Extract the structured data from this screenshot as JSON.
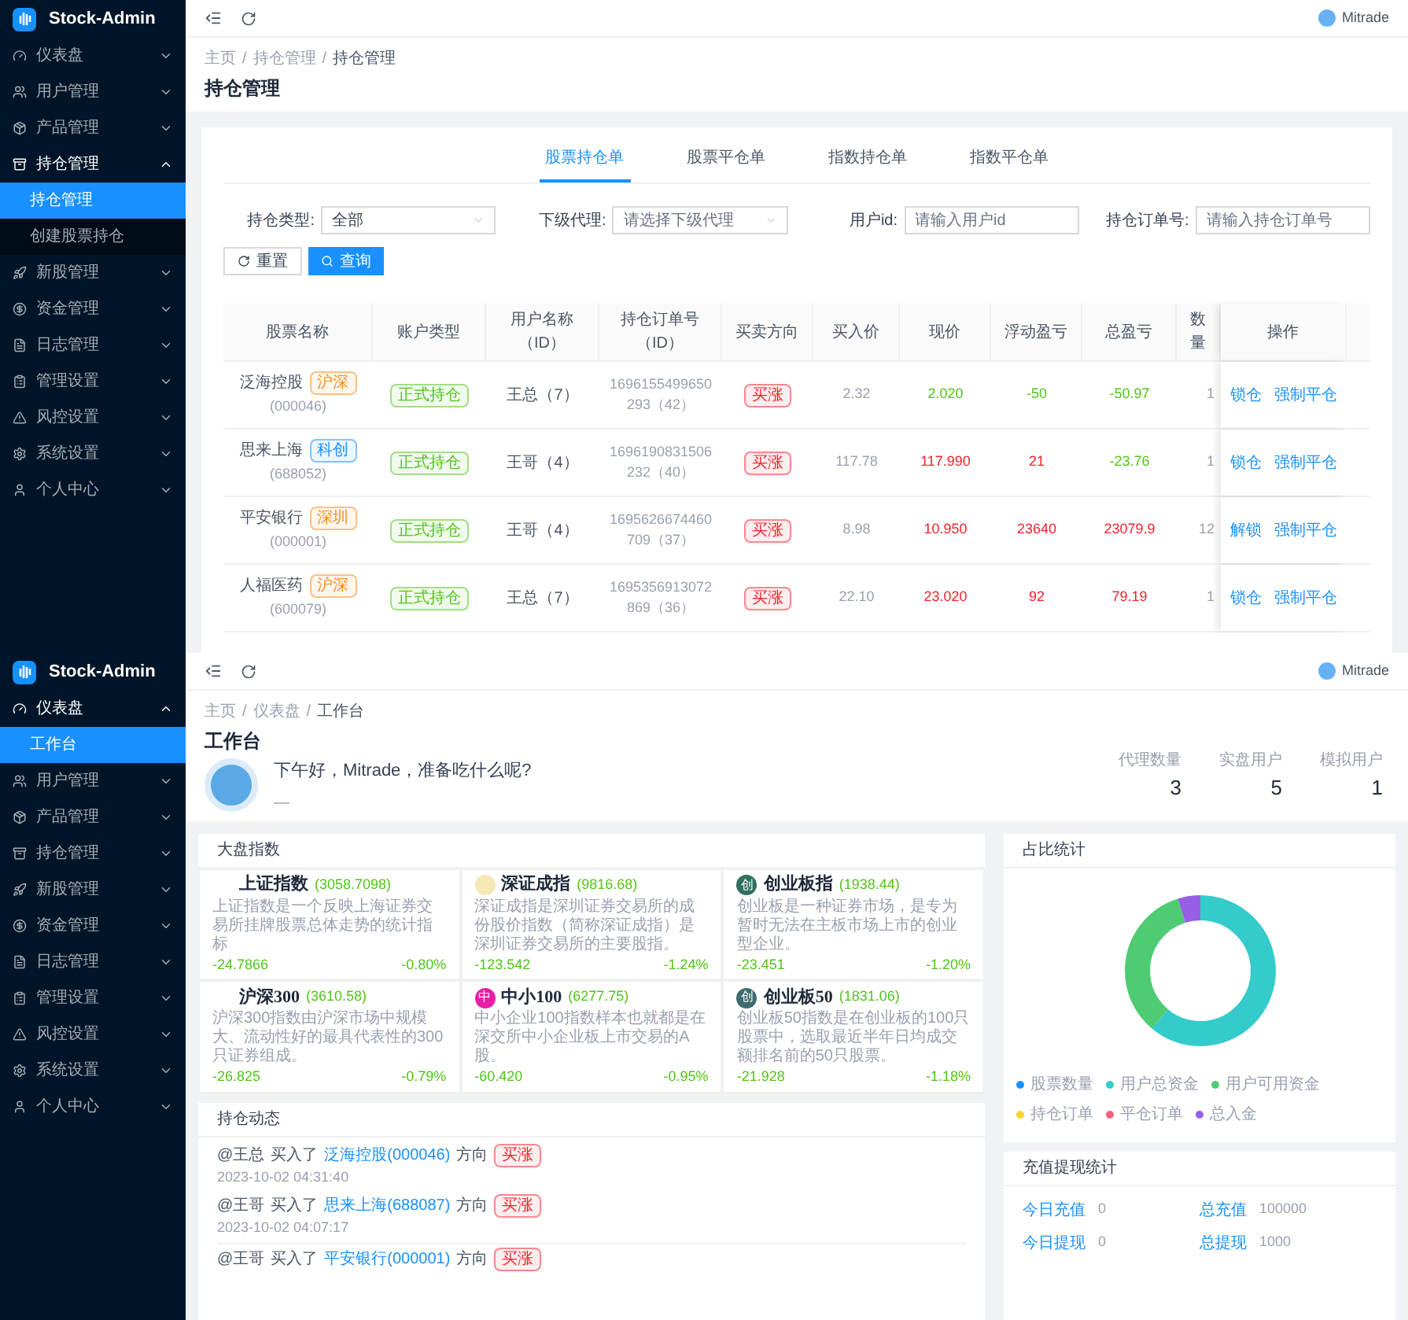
{
  "positions_screen": {
    "sidebar": {
      "logo": "Stock-Admin",
      "items": [
        {
          "label": "仪表盘",
          "expanded": false
        },
        {
          "label": "用户管理",
          "expanded": false
        },
        {
          "label": "产品管理",
          "expanded": false
        },
        {
          "label": "持仓管理",
          "expanded": true,
          "children": [
            {
              "label": "持仓管理",
              "selected": true
            },
            {
              "label": "创建股票持仓",
              "selected": false
            }
          ]
        },
        {
          "label": "新股管理",
          "expanded": false
        },
        {
          "label": "资金管理",
          "expanded": false
        },
        {
          "label": "日志管理",
          "expanded": false
        },
        {
          "label": "管理设置",
          "expanded": false
        },
        {
          "label": "风控设置",
          "expanded": false
        },
        {
          "label": "系统设置",
          "expanded": false
        },
        {
          "label": "个人中心",
          "expanded": false
        }
      ]
    },
    "header": {
      "user": "Mitrade"
    },
    "breadcrumb": [
      "主页",
      "持仓管理",
      "持仓管理"
    ],
    "breadcrumb_separator": "/",
    "title": "持仓管理",
    "tabs": [
      {
        "label": "股票持仓单",
        "selected": true
      },
      {
        "label": "股票平仓单",
        "selected": false
      },
      {
        "label": "指数持仓单",
        "selected": false
      },
      {
        "label": "指数平仓单",
        "selected": false
      }
    ],
    "filters": [
      {
        "kind": "select",
        "label": "持仓类型:",
        "value": "全部"
      },
      {
        "kind": "select",
        "label": "下级代理:",
        "placeholder": "请选择下级代理"
      },
      {
        "kind": "input",
        "label": "用户id:",
        "placeholder": "请输入用户id"
      },
      {
        "kind": "input",
        "label": "持仓订单号:",
        "placeholder": "请输入持仓订单号"
      }
    ],
    "buttons": [
      {
        "kind": "reset",
        "label": "重置"
      },
      {
        "kind": "search",
        "label": "查询"
      }
    ],
    "table": {
      "columns": [
        "股票名称",
        "账户类型",
        "用户名称（ID）",
        "持仓订单号（ID）",
        "买卖方向",
        "买入价",
        "现价",
        "浮动盈亏",
        "总盈亏",
        "数量",
        "操作"
      ],
      "rows": [
        {
          "name": "泛海控股",
          "tag": {
            "text": "沪深",
            "color": "#fa8c16"
          },
          "code": "(000046)",
          "account": "正式持仓",
          "user": "王总（7）",
          "order": "1696155499650293（42）",
          "direction": "买涨",
          "buy": "2.32",
          "price": {
            "text": "2.020",
            "color": "#52c41a"
          },
          "float": {
            "text": "-50",
            "color": "#52c41a"
          },
          "total": {
            "text": "-50.97",
            "color": "#52c41a"
          },
          "qty": "1",
          "actions": [
            "锁仓",
            "强制平仓"
          ]
        },
        {
          "name": "思来上海",
          "tag": {
            "text": "科创",
            "color": "#1890ff"
          },
          "code": "(688052)",
          "account": "正式持仓",
          "user": "王哥（4）",
          "order": "1696190831506232（40）",
          "direction": "买涨",
          "buy": "117.78",
          "price": {
            "text": "117.990",
            "color": "#f5222d"
          },
          "float": {
            "text": "21",
            "color": "#f5222d"
          },
          "total": {
            "text": "-23.76",
            "color": "#52c41a"
          },
          "qty": "1",
          "actions": [
            "锁仓",
            "强制平仓"
          ]
        },
        {
          "name": "平安银行",
          "tag": {
            "text": "深圳",
            "color": "#fa8c16"
          },
          "code": "(000001)",
          "account": "正式持仓",
          "user": "王哥（4）",
          "order": "1695626674460709（37）",
          "direction": "买涨",
          "buy": "8.98",
          "price": {
            "text": "10.950",
            "color": "#f5222d"
          },
          "float": {
            "text": "23640",
            "color": "#f5222d"
          },
          "total": {
            "text": "23079.9",
            "color": "#f5222d"
          },
          "qty": "12",
          "actions": [
            "解锁",
            "强制平仓"
          ]
        },
        {
          "name": "人福医药",
          "tag": {
            "text": "沪深",
            "color": "#fa8c16"
          },
          "code": "(600079)",
          "account": "正式持仓",
          "user": "王总（7）",
          "order": "1695356913072869（36）",
          "direction": "买涨",
          "buy": "22.10",
          "price": {
            "text": "23.020",
            "color": "#f5222d"
          },
          "float": {
            "text": "92",
            "color": "#f5222d"
          },
          "total": {
            "text": "79.19",
            "color": "#f5222d"
          },
          "qty": "1",
          "actions": [
            "锁仓",
            "强制平仓"
          ]
        }
      ]
    }
  },
  "dashboard_screen": {
    "sidebar": {
      "logo": "Stock-Admin",
      "items": [
        {
          "label": "仪表盘",
          "expanded": true,
          "children": [
            {
              "label": "工作台",
              "selected": true
            }
          ]
        },
        {
          "label": "用户管理",
          "expanded": false
        },
        {
          "label": "产品管理",
          "expanded": false
        },
        {
          "label": "持仓管理",
          "expanded": false
        },
        {
          "label": "新股管理",
          "expanded": false
        },
        {
          "label": "资金管理",
          "expanded": false
        },
        {
          "label": "日志管理",
          "expanded": false
        },
        {
          "label": "管理设置",
          "expanded": false
        },
        {
          "label": "风控设置",
          "expanded": false
        },
        {
          "label": "系统设置",
          "expanded": false
        },
        {
          "label": "个人中心",
          "expanded": false
        }
      ]
    },
    "header": {
      "user": "Mitrade"
    },
    "breadcrumb": [
      "主页",
      "仪表盘",
      "工作台"
    ],
    "breadcrumb_separator": "/",
    "title": "工作台",
    "greeting": "下午好，Mitrade，准备吃什么呢?",
    "greeting_subtitle": "—",
    "stats": [
      {
        "label": "代理数量",
        "value": "3"
      },
      {
        "label": "实盘用户",
        "value": "5"
      },
      {
        "label": "模拟用户",
        "value": "1"
      }
    ],
    "indices": {
      "title": "大盘指数",
      "items": [
        {
          "name": "上证指数",
          "value": "(3058.7098)",
          "description": "上证指数是一个反映上海证券交易所挂牌股票总体走势的统计指标",
          "change": "-24.7866",
          "percent": "-0.80%"
        },
        {
          "name": "深证成指",
          "value": "(9816.68)",
          "color": "#f6e7b6",
          "description": "深证成指是深圳证券交易所的成份股价指数（简称深证成指）是深圳证券交易所的主要股指。",
          "change": "-123.542",
          "percent": "-1.24%"
        },
        {
          "name": "创业板指",
          "value": "(1938.44)",
          "color": "#2f6f5e",
          "badge": "创",
          "description": "创业板是一种证券市场，是专为暂时无法在主板市场上市的创业型企业。",
          "change": "-23.451",
          "percent": "-1.20%"
        },
        {
          "name": "沪深300",
          "value": "(3610.58)",
          "description": "沪深300指数由沪深市场中规模大、流动性好的最具代表性的300只证券组成。",
          "change": "-26.825",
          "percent": "-0.79%"
        },
        {
          "name": "中小100",
          "value": "(6277.75)",
          "color": "#e81ea6",
          "badge": "中",
          "description": "中小企业100指数样本也就都是在深交所中小企业板上市交易的A股。",
          "change": "-60.420",
          "percent": "-0.95%"
        },
        {
          "name": "创业板50",
          "value": "(1831.06)",
          "color": "#3d6b70",
          "badge": "创",
          "description": "创业板50指数是在创业板的100只股票中，选取最近半年日均成交额排名前的50只股票。",
          "change": "-21.928",
          "percent": "-1.18%"
        }
      ]
    },
    "activity": {
      "title": "持仓动态",
      "items": [
        {
          "user": "@王总",
          "verb": "买入了",
          "stock": "泛海控股(000046)",
          "direction_label": "方向",
          "direction": "买涨",
          "time": "2023-10-02 04:31:40"
        },
        {
          "user": "@王哥",
          "verb": "买入了",
          "stock": "思来上海(688087)",
          "direction_label": "方向",
          "direction": "买涨",
          "time": "2023-10-02 04:07:17"
        },
        {
          "user": "@王哥",
          "verb": "买入了",
          "stock": "平安银行(000001)",
          "direction_label": "方向",
          "direction": "买涨"
        }
      ]
    },
    "ratio": {
      "title": "占比统计",
      "legend": [
        {
          "label": "股票数量",
          "color": "#1890ff"
        },
        {
          "label": "用户总资金",
          "color": "#36cbcb"
        },
        {
          "label": "用户可用资金",
          "color": "#4ecb73"
        },
        {
          "label": "持仓订单",
          "color": "#fbd437"
        },
        {
          "label": "平仓订单",
          "color": "#f2637b"
        },
        {
          "label": "总入金",
          "color": "#975fe5"
        }
      ]
    },
    "funds": {
      "title": "充值提现统计",
      "items": [
        {
          "label": "今日充值",
          "value": "0"
        },
        {
          "label": "总充值",
          "value": "100000"
        },
        {
          "label": "今日提现",
          "value": "0"
        },
        {
          "label": "总提现",
          "value": "1000"
        }
      ]
    }
  }
}
